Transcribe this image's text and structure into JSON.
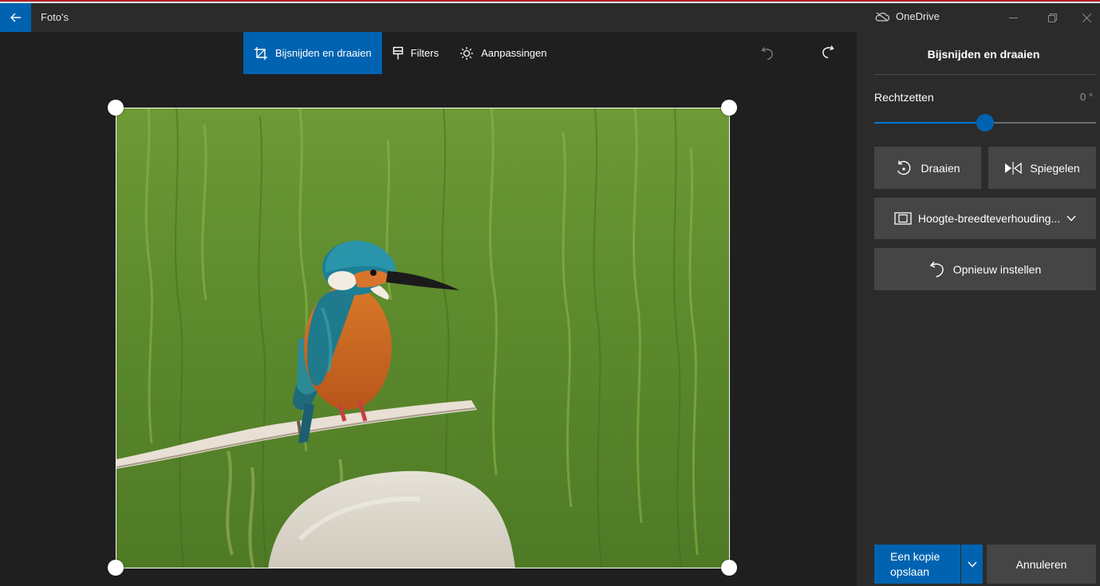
{
  "app": {
    "title": "Foto's",
    "onedrive_label": "OneDrive",
    "accent_color": "#0063b1"
  },
  "window_controls": [
    "minimize-icon",
    "restore-icon",
    "close-icon"
  ],
  "toolbar": {
    "tabs": [
      {
        "label": "Bijsnijden en draaien",
        "icon": "crop-icon",
        "active": true
      },
      {
        "label": "Filters",
        "icon": "filter-brush-icon",
        "active": false
      },
      {
        "label": "Aanpassingen",
        "icon": "brightness-icon",
        "active": false
      }
    ],
    "undo_icon": "undo-icon",
    "redo_icon": "redo-icon"
  },
  "photo": {
    "subject": "ijsvogel",
    "crop_handles": [
      "top-left",
      "top-right",
      "bottom-left",
      "bottom-right"
    ]
  },
  "panel": {
    "title": "Bijsnijden en draaien",
    "straighten": {
      "label": "Rechtzetten",
      "value": "0 °",
      "fraction": 0.5
    },
    "rotate_label": "Draaien",
    "flip_label": "Spiegelen",
    "aspect_label": "Hoogte-breedteverhouding...",
    "reset_label": "Opnieuw instellen",
    "save_line1": "Een kopie",
    "save_line2": "opslaan",
    "cancel_label": "Annuleren"
  }
}
